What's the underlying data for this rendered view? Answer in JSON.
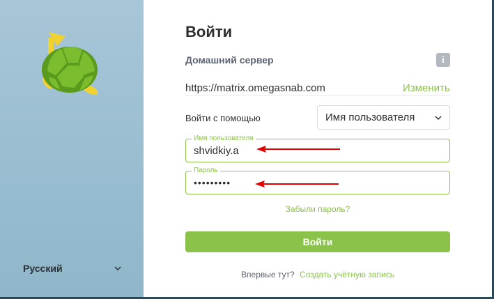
{
  "sidebar": {
    "language": "Русский",
    "logo_icon": "turtle-logo-icon",
    "chevron_icon": "chevron-down-icon"
  },
  "login": {
    "title": "Войти",
    "homeserver_heading": "Домашний сервер",
    "info_icon_label": "i",
    "homeserver_url": "https://matrix.omegasnab.com",
    "change_link": "Изменить",
    "login_with_label": "Войти с помощью",
    "login_type_selected": "Имя пользователя",
    "username_label": "Имя пользователя",
    "username_value": "shvidkiy.a",
    "password_label": "Пароль",
    "password_value": "•••••••••",
    "forgot_password": "Забыли пароль?",
    "submit_label": "Войти",
    "footer_prompt": "Впервые тут?",
    "create_account": "Создать учётную запись"
  },
  "colors": {
    "accent": "#8bc34a",
    "sidebar_bg": "#a7c6d8",
    "annotation_arrow": "#e00000",
    "text_primary": "#2e2f32",
    "text_secondary": "#5c6470"
  }
}
